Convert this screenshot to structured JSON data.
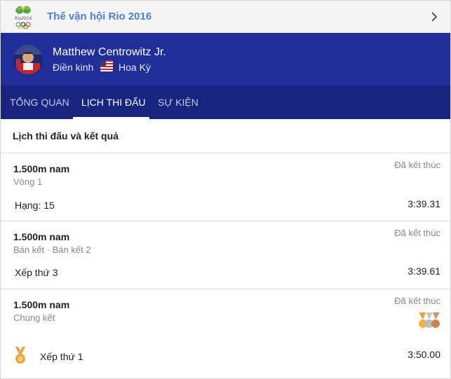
{
  "banner": {
    "title": "Thế vận hội Rio 2016",
    "logo_icon": "rio-2016-logo-icon",
    "chevron_icon": "chevron-right-icon"
  },
  "athlete": {
    "name": "Matthew Centrowitz Jr.",
    "sport": "Điền kinh",
    "country": "Hoa Kỳ",
    "flag_icon": "us-flag-icon"
  },
  "tabs": [
    {
      "label": "TỔNG QUAN",
      "active": false
    },
    {
      "label": "LỊCH THI ĐẤU",
      "active": true
    },
    {
      "label": "SỰ KIỆN",
      "active": false
    }
  ],
  "schedule": {
    "title": "Lịch thi đấu và kết quả",
    "events": [
      {
        "name": "1.500m nam",
        "round": "Vòng 1",
        "status": "Đã kết thúc",
        "result_label": "Hạng: 15",
        "result_time": "3:39.31"
      },
      {
        "name": "1.500m nam",
        "round": "Bán kết · Bán kết 2",
        "status": "Đã kết thúc",
        "result_label": "Xếp thứ 3",
        "result_time": "3:39.61"
      },
      {
        "name": "1.500m nam",
        "round": "Chung kết",
        "status": "Đã kết thúc",
        "result_label": "Xếp thứ 1",
        "result_time": "3:50.00",
        "medal": "gold-medal-icon"
      }
    ]
  },
  "colors": {
    "header_bg": "#1f2e99",
    "tabs_bg": "#18247d",
    "banner_title": "#4a7fd8",
    "gold": "#e8a23a"
  }
}
